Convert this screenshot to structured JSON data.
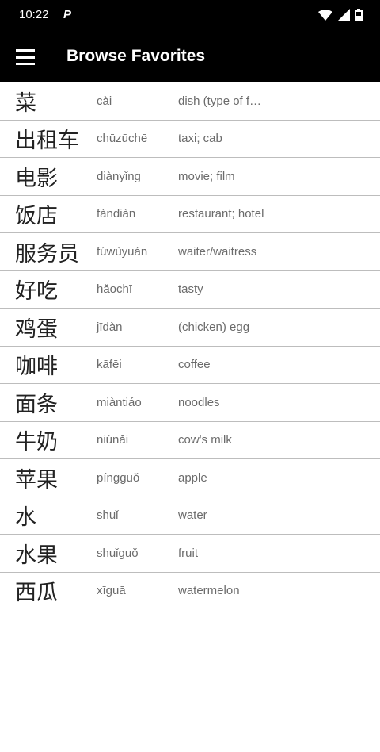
{
  "status_bar": {
    "time": "10:22",
    "app_indicator": "P",
    "icons": [
      "wifi-icon",
      "cell-signal-icon",
      "battery-icon"
    ]
  },
  "app_bar": {
    "menu_icon": "hamburger-menu-icon",
    "title": "Browse Favorites"
  },
  "favorites": [
    {
      "hanzi": "菜",
      "pinyin": "cài",
      "meaning": "dish (type of food)"
    },
    {
      "hanzi": "出租车",
      "pinyin": "chūzūchē",
      "meaning": "taxi; cab"
    },
    {
      "hanzi": "电影",
      "pinyin": "diànyǐng",
      "meaning": "movie; film"
    },
    {
      "hanzi": "饭店",
      "pinyin": "fàndiàn",
      "meaning": "restaurant; hotel"
    },
    {
      "hanzi": "服务员",
      "pinyin": "fúwùyuán",
      "meaning": "waiter/waitress"
    },
    {
      "hanzi": "好吃",
      "pinyin": "hǎochī",
      "meaning": "tasty"
    },
    {
      "hanzi": "鸡蛋",
      "pinyin": "jīdàn",
      "meaning": "(chicken) egg"
    },
    {
      "hanzi": "咖啡",
      "pinyin": "kāfēi",
      "meaning": "coffee"
    },
    {
      "hanzi": "面条",
      "pinyin": "miàntiáo",
      "meaning": "noodles"
    },
    {
      "hanzi": "牛奶",
      "pinyin": "niúnǎi",
      "meaning": "cow's milk"
    },
    {
      "hanzi": "苹果",
      "pinyin": "píngguǒ",
      "meaning": "apple"
    },
    {
      "hanzi": "水",
      "pinyin": "shuǐ",
      "meaning": "water"
    },
    {
      "hanzi": "水果",
      "pinyin": "shuǐguǒ",
      "meaning": "fruit"
    },
    {
      "hanzi": "西瓜",
      "pinyin": "xīguā",
      "meaning": "watermelon"
    }
  ]
}
